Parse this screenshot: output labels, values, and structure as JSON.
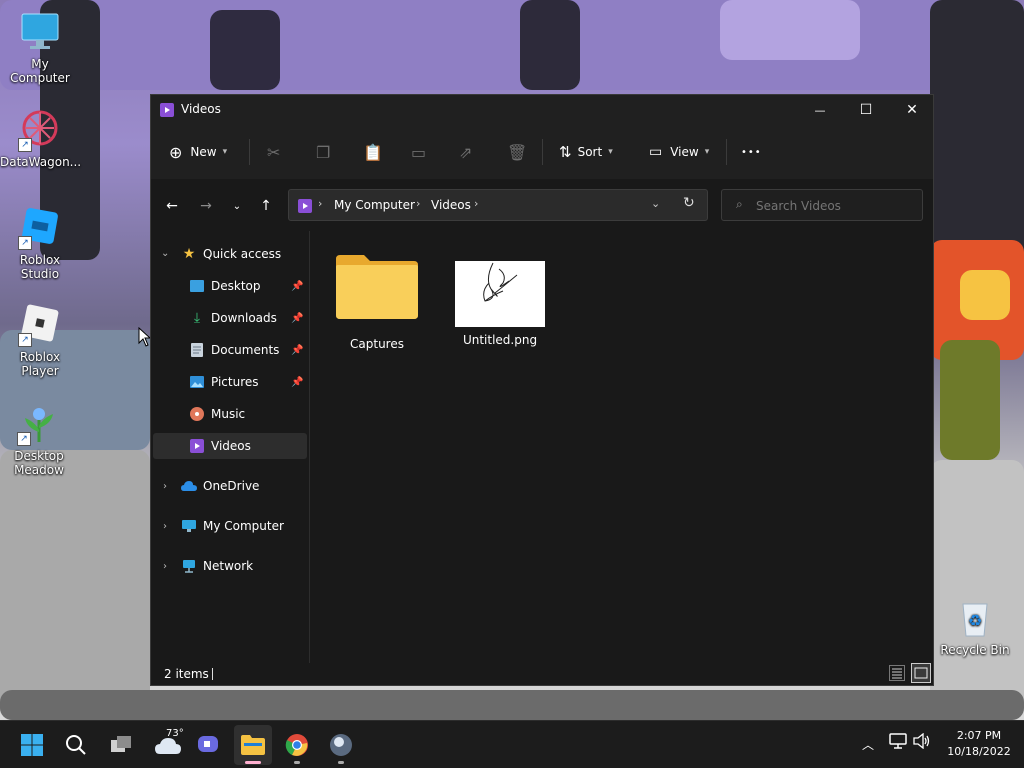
{
  "desktop": {
    "icons": [
      {
        "label": "My Computer"
      },
      {
        "label": "DataWagon..."
      },
      {
        "label": "Roblox Studio"
      },
      {
        "label": "Roblox Player"
      },
      {
        "label": "Desktop Meadow"
      },
      {
        "label": "Recycle Bin"
      }
    ]
  },
  "window": {
    "title": "Videos",
    "controls": {
      "minimize": "—",
      "maximize": "☐",
      "close": "✕"
    },
    "ribbon": {
      "new_label": "New",
      "sort_label": "Sort",
      "view_label": "View",
      "more_label": "•••"
    },
    "address": {
      "crumbs": [
        "My Computer",
        "Videos"
      ],
      "search_placeholder": "Search Videos"
    },
    "navpane": {
      "quick_access": "Quick access",
      "pinned": [
        {
          "label": "Desktop",
          "pinned": true
        },
        {
          "label": "Downloads",
          "pinned": true
        },
        {
          "label": "Documents",
          "pinned": true
        },
        {
          "label": "Pictures",
          "pinned": true
        },
        {
          "label": "Music",
          "pinned": false
        },
        {
          "label": "Videos",
          "pinned": false
        }
      ],
      "roots": [
        "OneDrive",
        "My Computer",
        "Network"
      ]
    },
    "files": [
      {
        "name": "Captures",
        "type": "folder"
      },
      {
        "name": "Untitled.png",
        "type": "image"
      }
    ],
    "status": {
      "item_count": "2 items"
    }
  },
  "taskbar": {
    "weather_temp": "73°",
    "time": "2:07 PM",
    "date": "10/18/2022"
  },
  "colors": {
    "accent": "#0078d4",
    "folder": "#f5c242",
    "selected_nav": "#2d2d2d"
  }
}
